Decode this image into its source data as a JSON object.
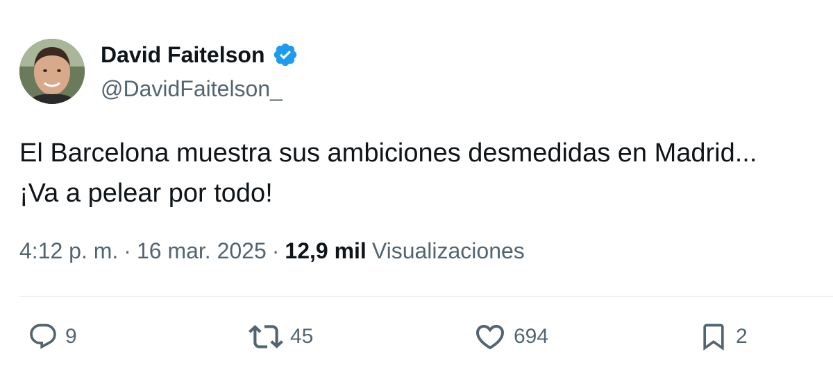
{
  "author": {
    "display_name": "David Faitelson",
    "handle": "@DavidFaitelson_",
    "avatar_icon": "avatar-photo",
    "verified_color": "#1d9bf0"
  },
  "tweet": {
    "text_line_1": "El Barcelona muestra sus ambiciones desmedidas en Madrid...",
    "text_line_2": "¡Va a pelear por todo!"
  },
  "meta": {
    "time": "4:12 p. m.",
    "separator": "·",
    "date": "16 mar. 2025",
    "views_count": "12,9 mil",
    "views_label": "Visualizaciones"
  },
  "actions": {
    "reply": {
      "icon": "reply-icon",
      "count": "9"
    },
    "retweet": {
      "icon": "retweet-icon",
      "count": "45"
    },
    "like": {
      "icon": "heart-icon",
      "count": "694"
    },
    "bookmark": {
      "icon": "bookmark-icon",
      "count": "2"
    }
  },
  "colors": {
    "text_primary": "#0f1419",
    "text_secondary": "#536471",
    "divider": "#dde3e8"
  }
}
